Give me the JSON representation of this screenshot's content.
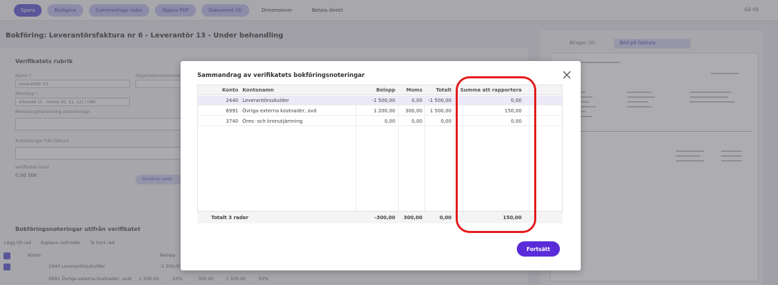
{
  "toolbar": {
    "buttons": [
      "Spara",
      "Redigera",
      "Sammanfoga rader",
      "Öppna PDF",
      "Dokument (0)",
      "Dimensioner",
      "Betala direkt"
    ],
    "right_label": "Gå till"
  },
  "page": {
    "title": "Bokföring: Leverantörsfaktura nr 6 - Leverantör 13 - Under behandling"
  },
  "background": {
    "section_title": "Verifikatets rubrik",
    "fields": {
      "name_label": "Namn *",
      "name_value": "Leverantör 13",
      "org_label": "Organisationsnummer",
      "moms_label": "Momstyp *",
      "moms_value": "Inhemsk (5 - moms 10, 11, 12) / (48)",
      "notes_label": "Remissingshänvisning anteckningar",
      "invoice_notes_label": "Anteckningar från faktura",
      "total_label": "Verifikatet totalt",
      "total_value": "0,00 SEK",
      "calc_button": "Beräkna saldo"
    },
    "right_tabs": [
      "Bilagor (0)",
      "Bild på faktura"
    ],
    "bottom_section_title": "Bokföringsnoteringar utifrån verifikatet",
    "bottom_tools": [
      "Lägg till rad",
      "Kopiera rad/rader",
      "Ta bort rad"
    ],
    "bottom_header": [
      "Konto",
      "Belopp"
    ],
    "bottom_rows": [
      [
        "2440 Leverantörsskulder",
        "-1 500,00"
      ],
      [
        "6991 Övriga externa kostnader, avdr",
        "1 200,00",
        "25%",
        "300,00",
        "1 500,00",
        "50%"
      ]
    ]
  },
  "modal": {
    "title": "Sammandrag av verifikatets bokföringsnoteringar",
    "columns": [
      "Konto",
      "Kontonamn",
      "Belopp",
      "Moms",
      "Totalt",
      "Summa att rapportera"
    ],
    "rows": [
      {
        "konto": "2440",
        "namn": "Leverantörsskulder",
        "belopp": "-1 500,00",
        "moms": "0,00",
        "totalt": "-1 500,00",
        "summa": "0,00"
      },
      {
        "konto": "6991",
        "namn": "Övriga externa kostnader, avd",
        "belopp": "1 200,00",
        "moms": "300,00",
        "totalt": "1 500,00",
        "summa": "150,00"
      },
      {
        "konto": "3740",
        "namn": "Öres- och kronutjämning",
        "belopp": "0,00",
        "moms": "0,00",
        "totalt": "0,00",
        "summa": "0,00"
      }
    ],
    "footer": {
      "label": "Totalt 3 rader",
      "belopp": "-300,00",
      "moms": "300,00",
      "totalt": "0,00",
      "summa": "150,00"
    },
    "continue_button": "Fortsätt"
  },
  "colors": {
    "accent": "#5a2bd8",
    "highlight": "#e41b1b"
  }
}
